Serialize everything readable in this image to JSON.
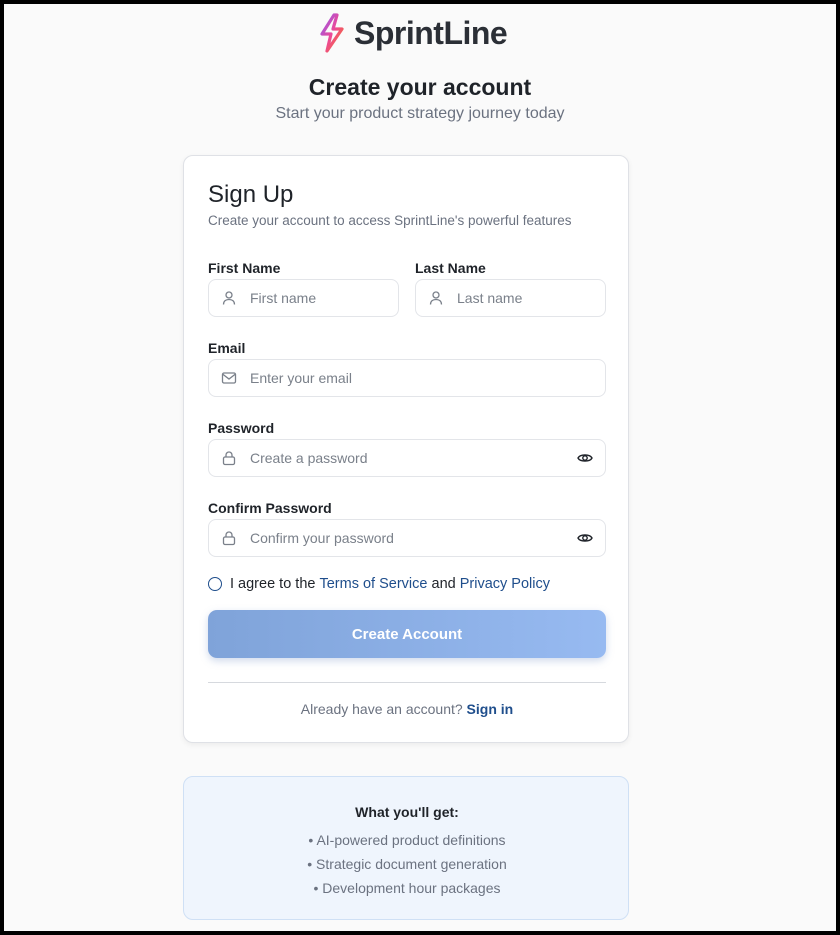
{
  "brand": {
    "name": "SprintLine",
    "icon": "bolt-logo-icon"
  },
  "page": {
    "title": "Create your account",
    "subtitle": "Start your product strategy journey today"
  },
  "form": {
    "title": "Sign Up",
    "subtitle": "Create your account to access SprintLine's powerful features",
    "first_name": {
      "label": "First Name",
      "placeholder": "First name",
      "value": ""
    },
    "last_name": {
      "label": "Last Name",
      "placeholder": "Last name",
      "value": ""
    },
    "email": {
      "label": "Email",
      "placeholder": "Enter your email",
      "value": ""
    },
    "password": {
      "label": "Password",
      "placeholder": "Create a password",
      "value": ""
    },
    "confirm_password": {
      "label": "Confirm Password",
      "placeholder": "Confirm your password",
      "value": ""
    },
    "agree": {
      "prefix": "I agree to the",
      "terms": "Terms of Service",
      "and": "and",
      "privacy": "Privacy Policy",
      "checked": false
    },
    "submit_label": "Create Account",
    "signin_prompt": "Already have an account?",
    "signin_link": "Sign in"
  },
  "benefits": {
    "title": "What you'll get:",
    "items": [
      "• AI-powered product definitions",
      "• Strategic document generation",
      "• Development hour packages"
    ]
  },
  "colors": {
    "accent": "#1f4e8c",
    "button_gradient_start": "#7fa3d9",
    "button_gradient_end": "#97baf1",
    "benefits_bg": "#eff5fd"
  }
}
